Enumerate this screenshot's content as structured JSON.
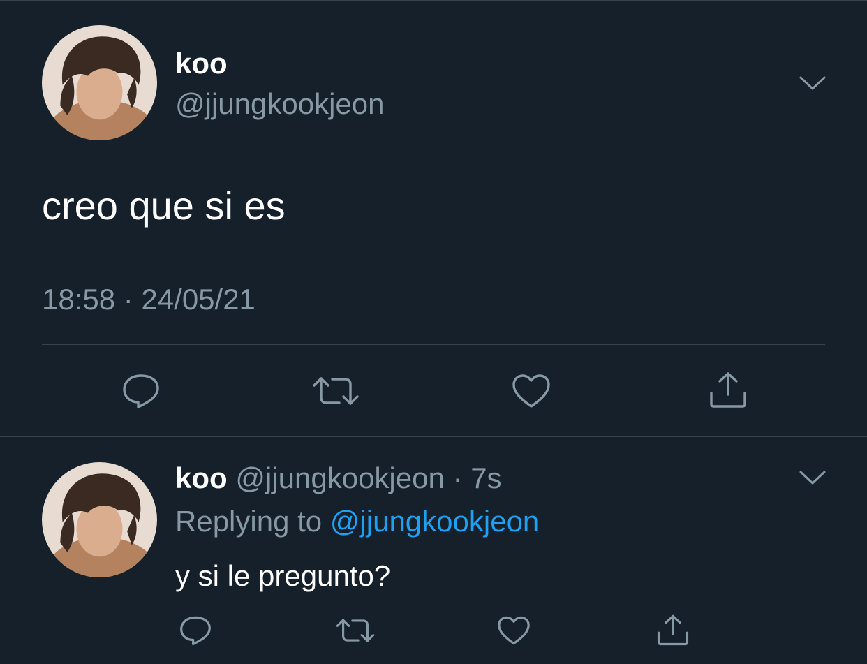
{
  "colors": {
    "background": "#15202b",
    "primary_text": "#ffffff",
    "secondary_text": "#8899a6",
    "link": "#1da1f2",
    "divider": "#38444d"
  },
  "main_tweet": {
    "author_name": "koo",
    "author_handle": "@jjungkookjeon",
    "text": "creo que si es",
    "meta": "18:58 · 24/05/21",
    "actions": [
      {
        "name": "reply",
        "icon": "reply-icon"
      },
      {
        "name": "retweet",
        "icon": "retweet-icon"
      },
      {
        "name": "like",
        "icon": "heart-icon"
      },
      {
        "name": "share",
        "icon": "share-icon"
      }
    ]
  },
  "reply_tweet": {
    "author_name": "koo",
    "author_handle": "@jjungkookjeon",
    "separator": "·",
    "time_ago": "7s",
    "replying_prefix": "Replying to",
    "replying_to": "@jjungkookjeon",
    "text": "y si le pregunto?",
    "actions": [
      {
        "name": "reply",
        "icon": "reply-icon"
      },
      {
        "name": "retweet",
        "icon": "retweet-icon"
      },
      {
        "name": "like",
        "icon": "heart-icon"
      },
      {
        "name": "share",
        "icon": "share-icon"
      }
    ]
  }
}
